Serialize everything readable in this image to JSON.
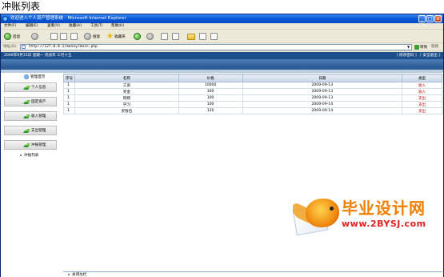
{
  "page_heading": "冲账列表",
  "window": {
    "title": "欢迎进入个人资产管理系统 - Microsoft Internet Explorer",
    "minimize_glyph": "_",
    "maximize_glyph": "□",
    "close_glyph": "x"
  },
  "menu": [
    "文件(F)",
    "编辑(E)",
    "查看(V)",
    "收藏(A)",
    "工具(T)",
    "帮助(H)"
  ],
  "toolbar": {
    "back": "后退",
    "search": "搜索",
    "favorites": "收藏夹"
  },
  "address_bar": {
    "label": "地址(D)",
    "url": "http://127.0.0.1/money/main.php",
    "go_label": "转到",
    "links_label": "链接"
  },
  "app_header": {
    "date": "2009年9月15日 星期一 丙戌年 三月十五",
    "links": [
      "[ 修改密码 ]",
      "[ 安全退出 ]"
    ]
  },
  "sidebar": {
    "home": "管理首页",
    "items": [
      "个人信息",
      "固定资产",
      "收入管理",
      "支出管理",
      "冲账管理"
    ],
    "active_sub": "冲账列表"
  },
  "table": {
    "columns": [
      "序号",
      "名称",
      "价格",
      "日期",
      "类型"
    ],
    "rows": [
      {
        "index": "1",
        "name": "工资",
        "price": "10000",
        "date": "2009-09-13",
        "type": "收入"
      },
      {
        "index": "1",
        "name": "奖金",
        "price": "300",
        "date": "2009-09-13",
        "type": "收入"
      },
      {
        "index": "1",
        "name": "购物",
        "price": "100",
        "date": "2009-09-13",
        "type": "支出"
      },
      {
        "index": "1",
        "name": "学习",
        "price": "100",
        "date": "2009-09-14",
        "type": "支出"
      },
      {
        "index": "1",
        "name": "买钱包",
        "price": "120",
        "date": "2009-09-14",
        "type": "支出"
      }
    ]
  },
  "footer": {
    "close_label": "关闭左栏"
  },
  "watermark": {
    "title": "毕业设计网",
    "url": "www.2BYSJ.com"
  },
  "colors": {
    "header_blue": "#1d4f8a",
    "type_red": "#c00000",
    "watermark_orange": "#f07f00"
  }
}
